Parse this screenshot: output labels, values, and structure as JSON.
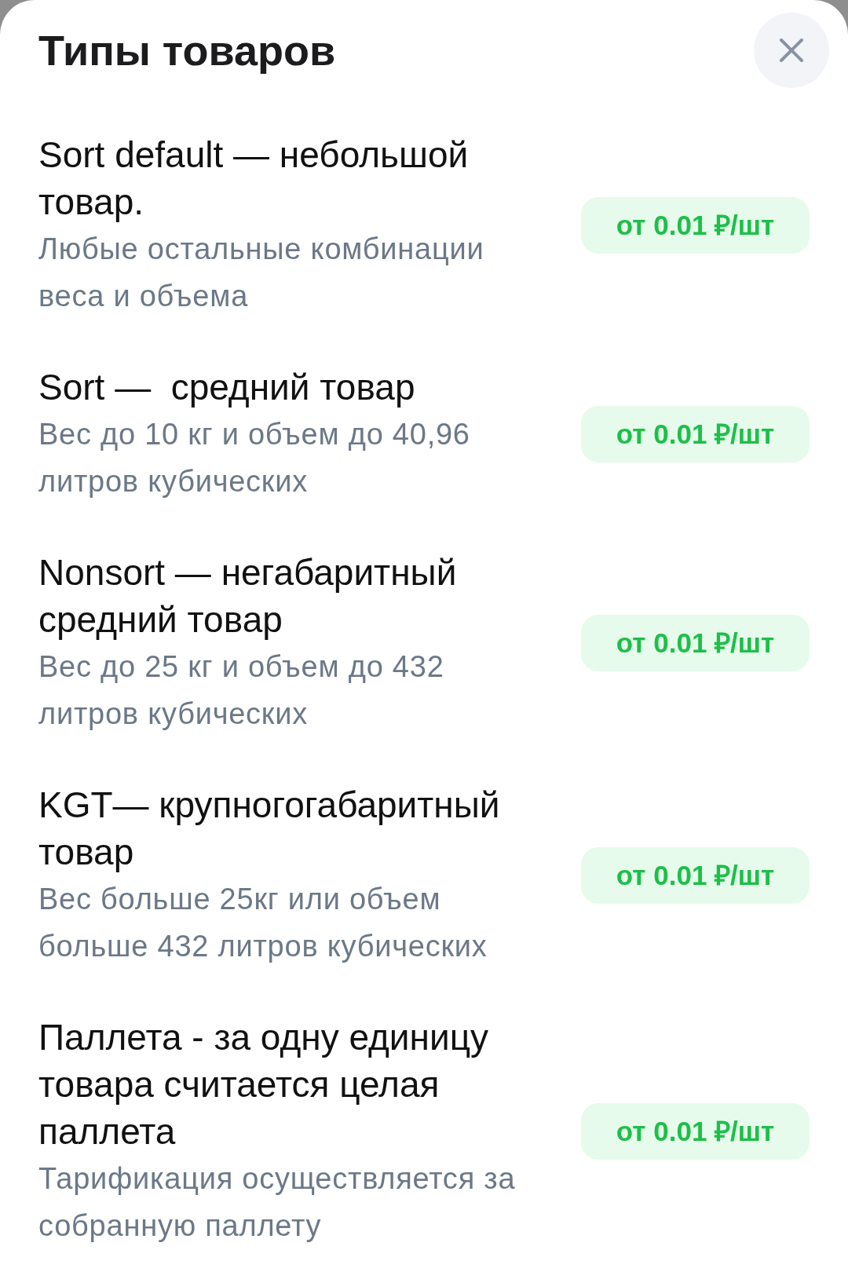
{
  "sheet": {
    "title": "Типы товаров"
  },
  "product_types": [
    {
      "name": "Sort default — небольшой товар.",
      "description": "Любые остальные комбинации веса и объема",
      "price": "от 0.01 ₽/шт"
    },
    {
      "name": "Sort —  средний товар",
      "description": "Вес до 10 кг и объем до 40,96 литров кубических",
      "price": "от 0.01 ₽/шт"
    },
    {
      "name": "Nonsort — негабаритный средний товар",
      "description": "Вес до 25 кг и объем до 432 литров кубических",
      "price": "от 0.01 ₽/шт"
    },
    {
      "name": "KGT— крупногогабаритный товар",
      "description": "Вес больше 25кг или объем больше 432 литров кубических",
      "price": "от 0.01 ₽/шт"
    },
    {
      "name": "Паллета - за одну единицу товара считается целая паллета",
      "description": "Тарификация осуществляется за собранную паллету",
      "price": "от 0.01 ₽/шт"
    }
  ]
}
